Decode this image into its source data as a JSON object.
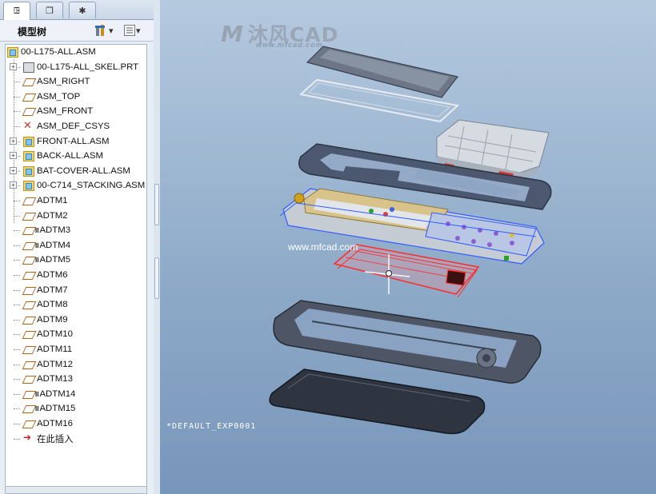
{
  "tabs": [
    {
      "name": "model-tree-tab",
      "icon": "model-tree-icon",
      "glyph": "ꖸ"
    },
    {
      "name": "folder-browser-tab",
      "icon": "folder-icon",
      "glyph": "❐"
    },
    {
      "name": "favorites-tab",
      "icon": "favorites-icon",
      "glyph": "✱"
    }
  ],
  "toolbar": {
    "title": "模型树",
    "settings_icon": "tree-settings-icon",
    "show_icon": "tree-show-icon",
    "settings_caret": "▾",
    "show_caret": "▾"
  },
  "tree": {
    "root": "00-L175-ALL.ASM",
    "items": [
      {
        "label": "00-L175-ALL_SKEL.PRT",
        "type": "prt",
        "expandable": true,
        "hidden": false
      },
      {
        "label": "ASM_RIGHT",
        "type": "datum",
        "expandable": false,
        "hidden": false
      },
      {
        "label": "ASM_TOP",
        "type": "datum",
        "expandable": false,
        "hidden": false
      },
      {
        "label": "ASM_FRONT",
        "type": "datum",
        "expandable": false,
        "hidden": false
      },
      {
        "label": "ASM_DEF_CSYS",
        "type": "csys",
        "expandable": false,
        "hidden": false
      },
      {
        "label": "FRONT-ALL.ASM",
        "type": "asm",
        "expandable": true,
        "hidden": false
      },
      {
        "label": "BACK-ALL.ASM",
        "type": "asm",
        "expandable": true,
        "hidden": false
      },
      {
        "label": "BAT-COVER-ALL.ASM",
        "type": "asm",
        "expandable": true,
        "hidden": false
      },
      {
        "label": "00-C714_STACKING.ASM",
        "type": "asm",
        "expandable": true,
        "hidden": false
      },
      {
        "label": "ADTM1",
        "type": "datum",
        "expandable": false,
        "hidden": false
      },
      {
        "label": "ADTM2",
        "type": "datum",
        "expandable": false,
        "hidden": false
      },
      {
        "label": "ADTM3",
        "type": "datum",
        "expandable": false,
        "hidden": true
      },
      {
        "label": "ADTM4",
        "type": "datum",
        "expandable": false,
        "hidden": true
      },
      {
        "label": "ADTM5",
        "type": "datum",
        "expandable": false,
        "hidden": true
      },
      {
        "label": "ADTM6",
        "type": "datum",
        "expandable": false,
        "hidden": false
      },
      {
        "label": "ADTM7",
        "type": "datum",
        "expandable": false,
        "hidden": false
      },
      {
        "label": "ADTM8",
        "type": "datum",
        "expandable": false,
        "hidden": false
      },
      {
        "label": "ADTM9",
        "type": "datum",
        "expandable": false,
        "hidden": false
      },
      {
        "label": "ADTM10",
        "type": "datum",
        "expandable": false,
        "hidden": false
      },
      {
        "label": "ADTM11",
        "type": "datum",
        "expandable": false,
        "hidden": false
      },
      {
        "label": "ADTM12",
        "type": "datum",
        "expandable": false,
        "hidden": false
      },
      {
        "label": "ADTM13",
        "type": "datum",
        "expandable": false,
        "hidden": false
      },
      {
        "label": "ADTM14",
        "type": "datum",
        "expandable": false,
        "hidden": true
      },
      {
        "label": "ADTM15",
        "type": "datum",
        "expandable": false,
        "hidden": true
      },
      {
        "label": "ADTM16",
        "type": "datum",
        "expandable": false,
        "hidden": false
      },
      {
        "label": "在此插入",
        "type": "insert",
        "expandable": false,
        "hidden": false
      }
    ],
    "hidden_mark": "II"
  },
  "viewport": {
    "logo_text": "沐风CAD",
    "logo_url": "www.mfcad.com",
    "watermark": "www.mfcad.com",
    "explode_state": "*DEFAULT_EXP0001"
  },
  "colors": {
    "selection_red": "#ff2a2a",
    "highlight_blue": "#2e5bff",
    "part_dark": "#4b5870",
    "part_light": "#e7ebf0"
  }
}
